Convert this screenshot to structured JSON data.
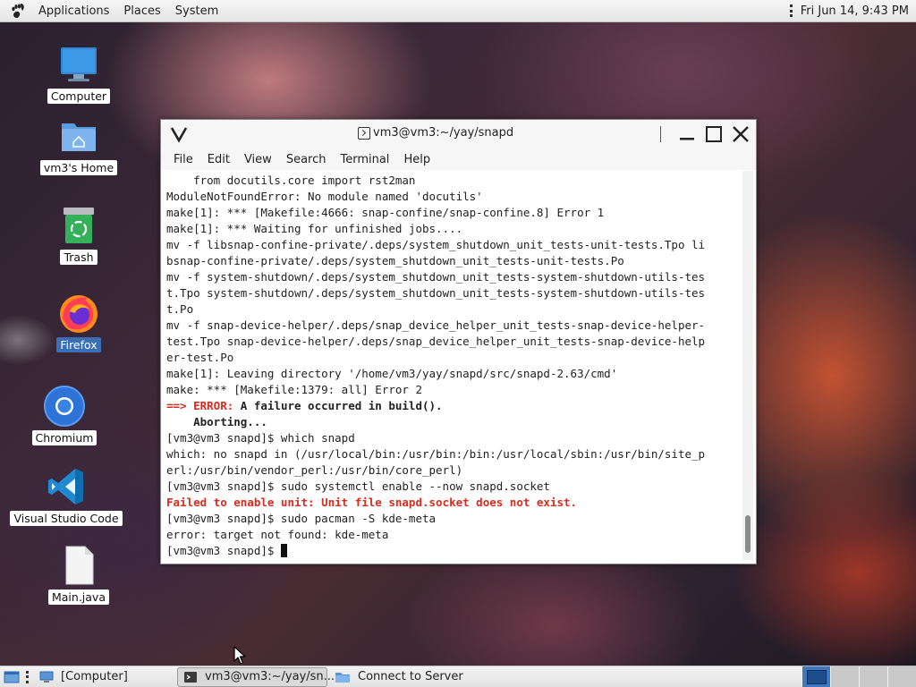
{
  "top_panel": {
    "menus": [
      "Applications",
      "Places",
      "System"
    ],
    "clock": "Fri Jun 14,  9:43 PM"
  },
  "desktop": {
    "icons": [
      {
        "label": "Computer",
        "icon": "computer-icon",
        "selected": false
      },
      {
        "label": "vm3's Home",
        "icon": "home-folder-icon",
        "selected": false
      },
      {
        "label": "Trash",
        "icon": "trash-icon",
        "selected": false
      },
      {
        "label": "Firefox",
        "icon": "firefox-icon",
        "selected": true
      },
      {
        "label": "Chromium",
        "icon": "chromium-icon",
        "selected": false
      },
      {
        "label": "Visual Studio Code",
        "icon": "vscode-icon",
        "selected": false
      },
      {
        "label": "Main.java",
        "icon": "file-icon",
        "selected": false
      }
    ]
  },
  "terminal": {
    "title": "vm3@vm3:~/yay/snapd",
    "menu": [
      "File",
      "Edit",
      "View",
      "Search",
      "Terminal",
      "Help"
    ],
    "lines": [
      [
        {
          "t": "    from docutils.core import rst2man"
        }
      ],
      [
        {
          "t": "ModuleNotFoundError: No module named 'docutils'"
        }
      ],
      [
        {
          "t": "make[1]: *** [Makefile:4666: snap-confine/snap-confine.8] Error 1"
        }
      ],
      [
        {
          "t": "make[1]: *** Waiting for unfinished jobs...."
        }
      ],
      [
        {
          "t": "mv -f libsnap-confine-private/.deps/system_shutdown_unit_tests-unit-tests.Tpo li"
        }
      ],
      [
        {
          "t": "bsnap-confine-private/.deps/system_shutdown_unit_tests-unit-tests.Po"
        }
      ],
      [
        {
          "t": "mv -f system-shutdown/.deps/system_shutdown_unit_tests-system-shutdown-utils-tes"
        }
      ],
      [
        {
          "t": "t.Tpo system-shutdown/.deps/system_shutdown_unit_tests-system-shutdown-utils-tes"
        }
      ],
      [
        {
          "t": "t.Po"
        }
      ],
      [
        {
          "t": "mv -f snap-device-helper/.deps/snap_device_helper_unit_tests-snap-device-helper-"
        }
      ],
      [
        {
          "t": "test.Tpo snap-device-helper/.deps/snap_device_helper_unit_tests-snap-device-help"
        }
      ],
      [
        {
          "t": "er-test.Po"
        }
      ],
      [
        {
          "t": "make[1]: Leaving directory '/home/vm3/yay/snapd/src/snapd-2.63/cmd'"
        }
      ],
      [
        {
          "t": "make: *** [Makefile:1379: all] Error 2"
        }
      ],
      [
        {
          "t": "==> ERROR:",
          "s": "red"
        },
        {
          "t": " A failure occurred in build().",
          "s": "bold"
        }
      ],
      [
        {
          "t": "    Aborting...",
          "s": "bold"
        }
      ],
      [
        {
          "t": "[vm3@vm3 snapd]$ which snapd"
        }
      ],
      [
        {
          "t": "which: no snapd in (/usr/local/bin:/usr/bin:/bin:/usr/local/sbin:/usr/bin/site_p"
        }
      ],
      [
        {
          "t": "erl:/usr/bin/vendor_perl:/usr/bin/core_perl)"
        }
      ],
      [
        {
          "t": "[vm3@vm3 snapd]$ sudo systemctl enable --now snapd.socket"
        }
      ],
      [
        {
          "t": "Failed to enable unit: Unit file snapd.socket does not exist.",
          "s": "red"
        }
      ],
      [
        {
          "t": "[vm3@vm3 snapd]$ sudo pacman -S kde-meta"
        }
      ],
      [
        {
          "t": "error: target not found: kde-meta"
        }
      ],
      [
        {
          "t": "[vm3@vm3 snapd]$ "
        },
        {
          "cursor": true
        }
      ]
    ]
  },
  "taskbar": {
    "tasks": [
      {
        "label": "[Computer]",
        "icon": "computer-icon",
        "active": false
      },
      {
        "label": "vm3@vm3:~/yay/sn...",
        "icon": "terminal-icon",
        "active": true
      },
      {
        "label": "Connect to Server",
        "icon": "folder-icon",
        "active": false
      }
    ],
    "workspace_count": 4,
    "active_workspace": 1
  },
  "colors": {
    "error_red": "#d72c1f",
    "selection_blue": "#3a6fb7",
    "workspace_active": "#3d79c0"
  }
}
